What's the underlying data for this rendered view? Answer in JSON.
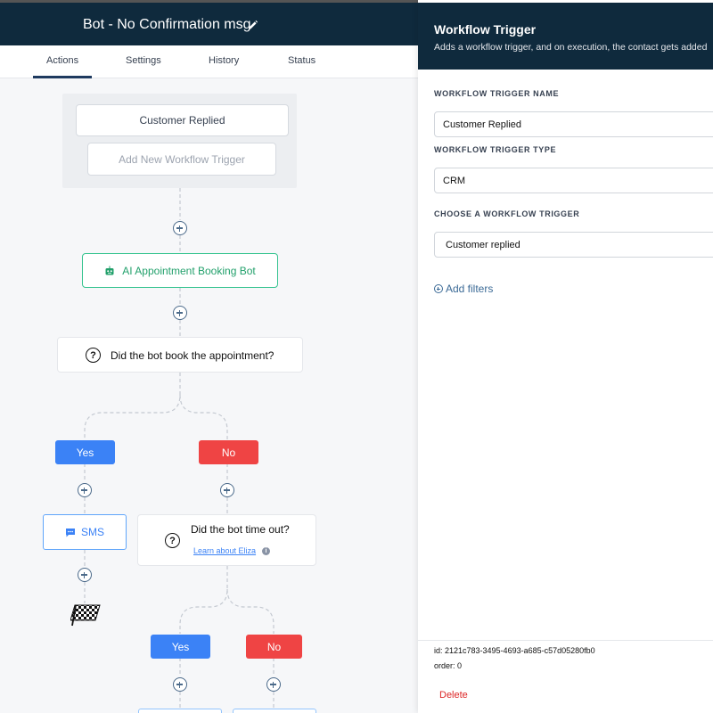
{
  "header": {
    "workflow_title": "Bot - No Confirmation msg",
    "edit_icon": "pencil-icon"
  },
  "tabs": [
    {
      "label": "Actions",
      "active": true
    },
    {
      "label": "Settings",
      "active": false
    },
    {
      "label": "History",
      "active": false
    },
    {
      "label": "Status",
      "active": false
    }
  ],
  "canvas": {
    "trigger": "Customer Replied",
    "add_trigger_label": "Add New Workflow Trigger",
    "ai_bot_label": "AI Appointment Booking Bot",
    "condition_1": "Did the bot book the appointment?",
    "yes_label": "Yes",
    "no_label": "No",
    "sms_label": "SMS",
    "condition_2": "Did the bot time out?",
    "learn_link": "Learn about Eliza",
    "yes_label_2": "Yes",
    "no_label_2": "No"
  },
  "panel": {
    "title": "Workflow Trigger",
    "description": "Adds a workflow trigger, and on execution, the contact gets added",
    "name_label": "WORKFLOW TRIGGER NAME",
    "name_value": "Customer Replied",
    "type_label": "WORKFLOW TRIGGER TYPE",
    "type_value": "CRM",
    "choose_label": "CHOOSE A WORKFLOW TRIGGER",
    "choose_value": "Customer replied",
    "add_filters": "Add filters",
    "id_line": "id: 2121c783-3495-4693-a685-c57d05280fb0",
    "order_line": "order: 0",
    "delete_label": "Delete"
  },
  "colors": {
    "header_bg": "#0f2a3d",
    "yes_branch": "#3b82f6",
    "no_branch": "#ef4444",
    "bot_accent": "#22a06b",
    "delete": "#dc2626"
  }
}
